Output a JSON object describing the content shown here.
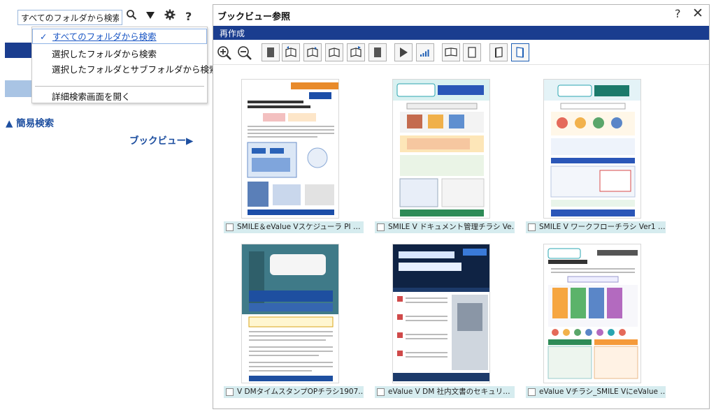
{
  "search": {
    "value": "すべてのフォルダから検索"
  },
  "dropdown": {
    "items": [
      {
        "label": "すべてのフォルダから検索",
        "selected": true
      },
      {
        "label": "選択したフォルダから検索"
      },
      {
        "label": "選択したフォルダとサブフォルダから検索"
      },
      {
        "label": "詳細検索画面を開く"
      }
    ],
    "check": "✓"
  },
  "left": {
    "simple_search": "▲ 簡易検索",
    "bookview_link": "ブックビュー▶"
  },
  "dialog": {
    "title": "ブックビュー参照",
    "help": "?",
    "close": "✕",
    "menu": {
      "recreate": "再作成"
    }
  },
  "cards": [
    {
      "caption": "SMILE＆eValue Vスケジューラ PI …",
      "thumb_theme": "osk"
    },
    {
      "caption": "SMILE V ドキュメント管理チラシ Ve…",
      "thumb_theme": "smile-doc"
    },
    {
      "caption": "SMILE V ワークフローチラシ Ver1 …",
      "thumb_theme": "smile-wf"
    },
    {
      "caption": "V DMタイムスタンプOPチラシ1907…",
      "thumb_theme": "evalue-ts"
    },
    {
      "caption": "eValue V DM 社内文書のセキュリ…",
      "thumb_theme": "evalue-sec"
    },
    {
      "caption": "eValue Vチラシ_SMILE VにeValue …",
      "thumb_theme": "smile-info"
    }
  ],
  "colors": {
    "brand_navy": "#1a3d8f",
    "link_blue": "#1e4fa0",
    "caption_bg": "#d6ecef"
  }
}
